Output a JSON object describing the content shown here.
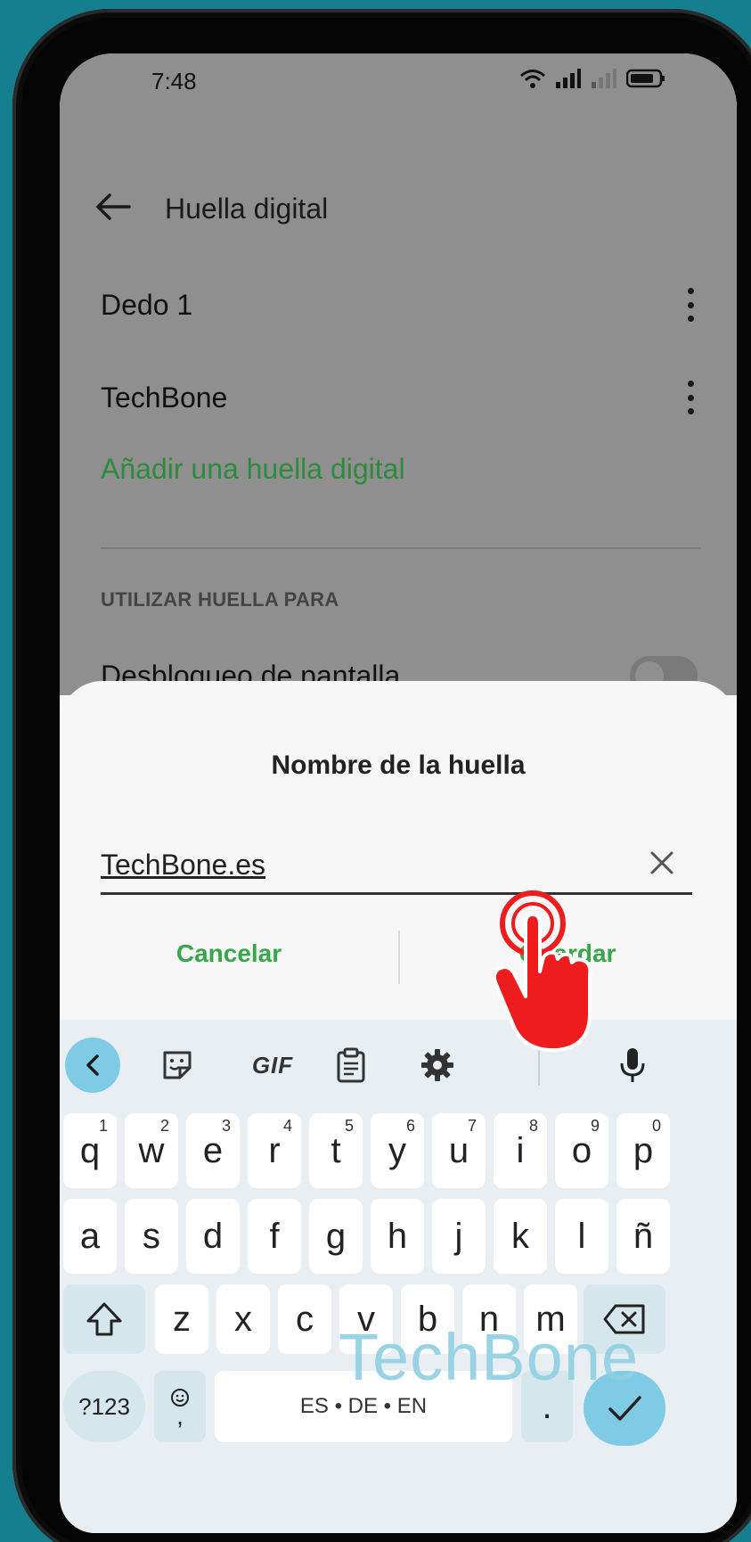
{
  "status": {
    "time": "7:48"
  },
  "appbar": {
    "title": "Huella digital"
  },
  "fingerprints": [
    {
      "label": "Dedo 1"
    },
    {
      "label": "TechBone"
    }
  ],
  "add_link": "Añadir una huella digital",
  "section_header": "UTILIZAR HUELLA PARA",
  "partial_row": "Desbloqueo de pantalla",
  "dialog": {
    "title": "Nombre de la huella",
    "input_value": "TechBone.es",
    "cancel_label": "Cancelar",
    "save_label": "Guardar"
  },
  "keyboard": {
    "toolbar": {
      "gif": "GIF"
    },
    "row1": [
      {
        "k": "q",
        "h": "1"
      },
      {
        "k": "w",
        "h": "2"
      },
      {
        "k": "e",
        "h": "3"
      },
      {
        "k": "r",
        "h": "4"
      },
      {
        "k": "t",
        "h": "5"
      },
      {
        "k": "y",
        "h": "6"
      },
      {
        "k": "u",
        "h": "7"
      },
      {
        "k": "i",
        "h": "8"
      },
      {
        "k": "o",
        "h": "9"
      },
      {
        "k": "p",
        "h": "0"
      }
    ],
    "row2": [
      "a",
      "s",
      "d",
      "f",
      "g",
      "h",
      "j",
      "k",
      "l",
      "ñ"
    ],
    "row3": [
      "z",
      "x",
      "c",
      "v",
      "b",
      "n",
      "m"
    ],
    "symbols_label": "?123",
    "emoji_comma": ",",
    "space_label": "ES • DE • EN",
    "period_label": "."
  },
  "watermark": "TechBone",
  "colors": {
    "accent_green": "#37a84a",
    "link_green": "#2e8a3c",
    "keyboard_accent": "#7fcbe6",
    "background": "#157f90"
  }
}
